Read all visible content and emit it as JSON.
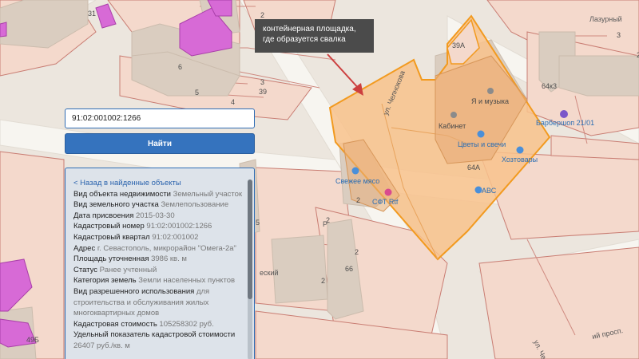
{
  "map": {
    "colors": {
      "background": "#ece6de",
      "parcel": "#f4d9cc",
      "parcel_border": "#c97d73",
      "building": "#dacdc0",
      "highlight_fill": "#f8c28c",
      "highlight_border": "#f29a1f",
      "magenta": "#d76ad6",
      "road": "#f7f5f0"
    },
    "place_labels": {
      "lazurny": "Лазурный"
    },
    "house_numbers": {
      "n31": "31",
      "n2a": "2",
      "n39a_top": "39А",
      "n6": "6",
      "n3": "3",
      "n39": "39",
      "n5": "5",
      "n4": "4",
      "n64k3": "64к3",
      "n64a": "64А",
      "n66": "66",
      "n2b": "2",
      "n2c": "2",
      "n49b": "49Б",
      "n5b": "5",
      "n2d": "2",
      "n3b": "3",
      "n2e": "2",
      "n2f": "2"
    },
    "streets": {
      "chelnokova": "ул. Челнокова",
      "chelnokova2": "ул. Челнок",
      "prosp": "ий просп.",
      "eskiy": "еский",
      "r": "Р"
    },
    "pois": {
      "ya_i_muzyka": "Я и музыка",
      "kabinet": "Кабинет",
      "tsvety": "Цветы и свечи",
      "khoztovary": "Хозтовары",
      "avs": "АВС",
      "svezhee": "Свежее мясо",
      "sft": "СФТ Rtf",
      "barbershop": "Барбершоп 21/01"
    }
  },
  "search": {
    "value": "91:02:001002:1266",
    "button_label": "Найти"
  },
  "info": {
    "back_label": "< Назад в найденные объекты",
    "rows": [
      {
        "label": "Вид объекта недвижимости",
        "value": "Земельный участок"
      },
      {
        "label": "Вид земельного участка",
        "value": "Землепользование"
      },
      {
        "label": "Дата присвоения",
        "value": "2015-03-30"
      },
      {
        "label": "Кадастровый номер",
        "value": "91:02:001002:1266"
      },
      {
        "label": "Кадастровый квартал",
        "value": "91:02:001002"
      },
      {
        "label": "Адрес",
        "value": "г. Севастополь, микрорайон \"Омега-2а\""
      },
      {
        "label": "Площадь уточненная",
        "value": "3986 кв. м"
      },
      {
        "label": "Статус",
        "value": "Ранее учтенный"
      },
      {
        "label": "Категория земель",
        "value": "Земли населенных пунктов"
      },
      {
        "label": "Вид разрешенного использования",
        "value": "для строительства и обслуживания жилых многоквартирных домов"
      },
      {
        "label": "Кадастровая стоимость",
        "value": "105258302 руб."
      },
      {
        "label": "Удельный показатель кадастровой стоимости",
        "value": "26407 руб./кв. м"
      }
    ]
  },
  "tooltip": {
    "line1": "контейнерная площадка,",
    "line2": "где образуется свалка"
  }
}
